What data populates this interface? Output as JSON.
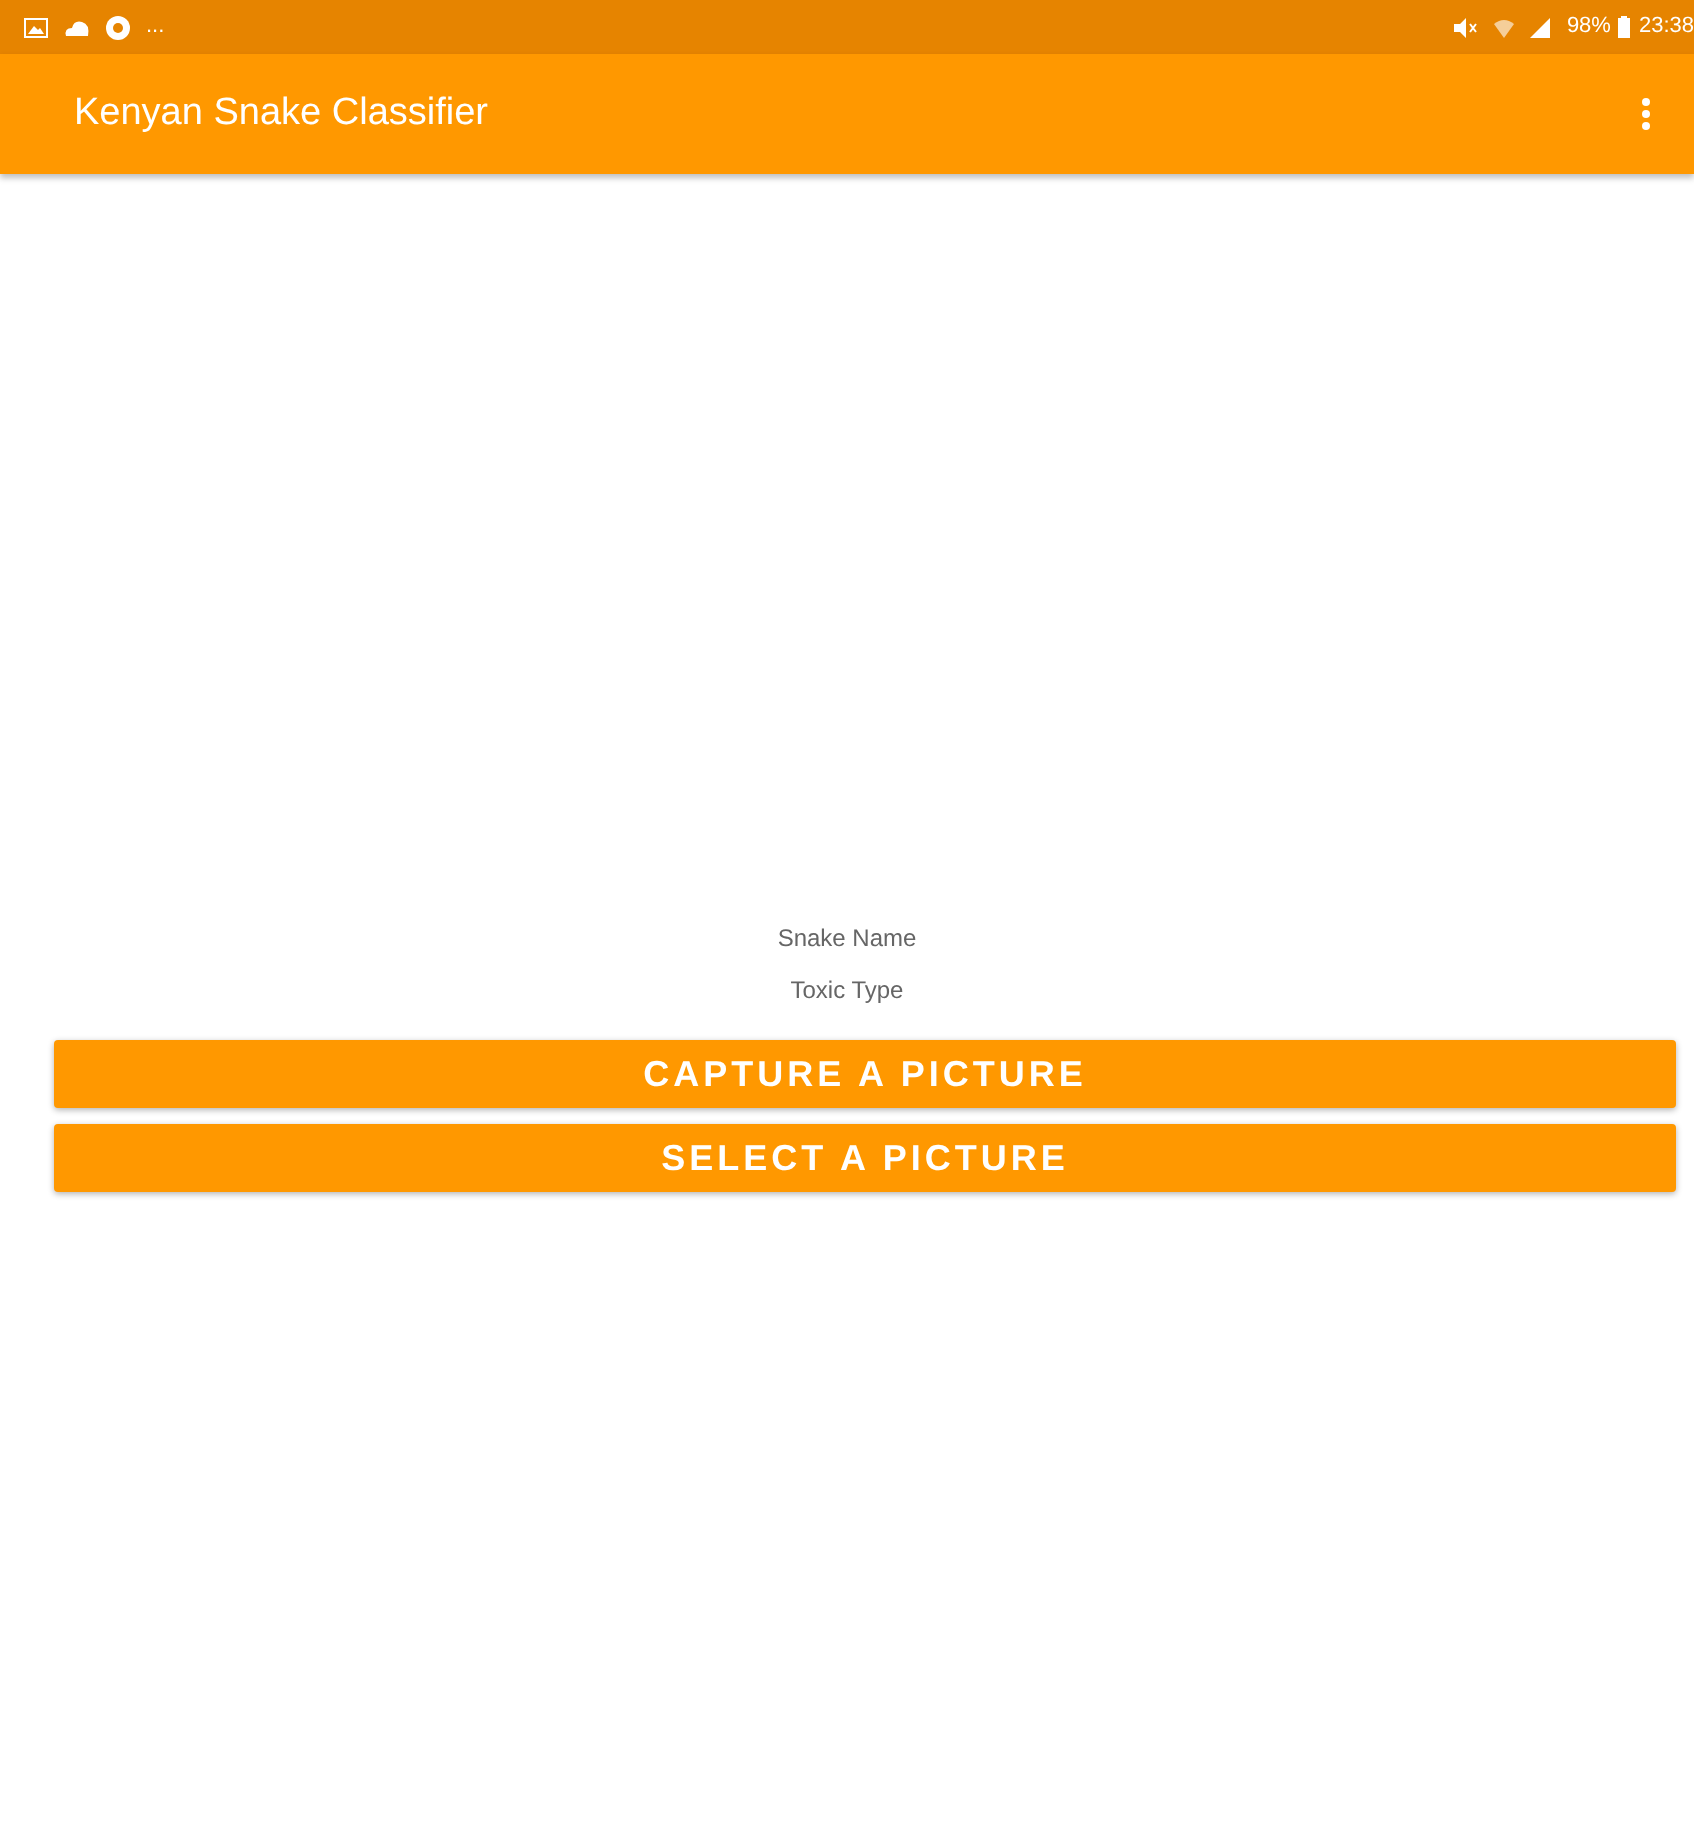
{
  "status_bar": {
    "overflow": "...",
    "battery": "98%",
    "time": "23:38"
  },
  "app_bar": {
    "title": "Kenyan Snake Classifier"
  },
  "result": {
    "snake_name": "Snake Name",
    "toxic_type": "Toxic Type"
  },
  "buttons": [
    "CAPTURE A PICTURE",
    "SELECT A PICTURE"
  ]
}
